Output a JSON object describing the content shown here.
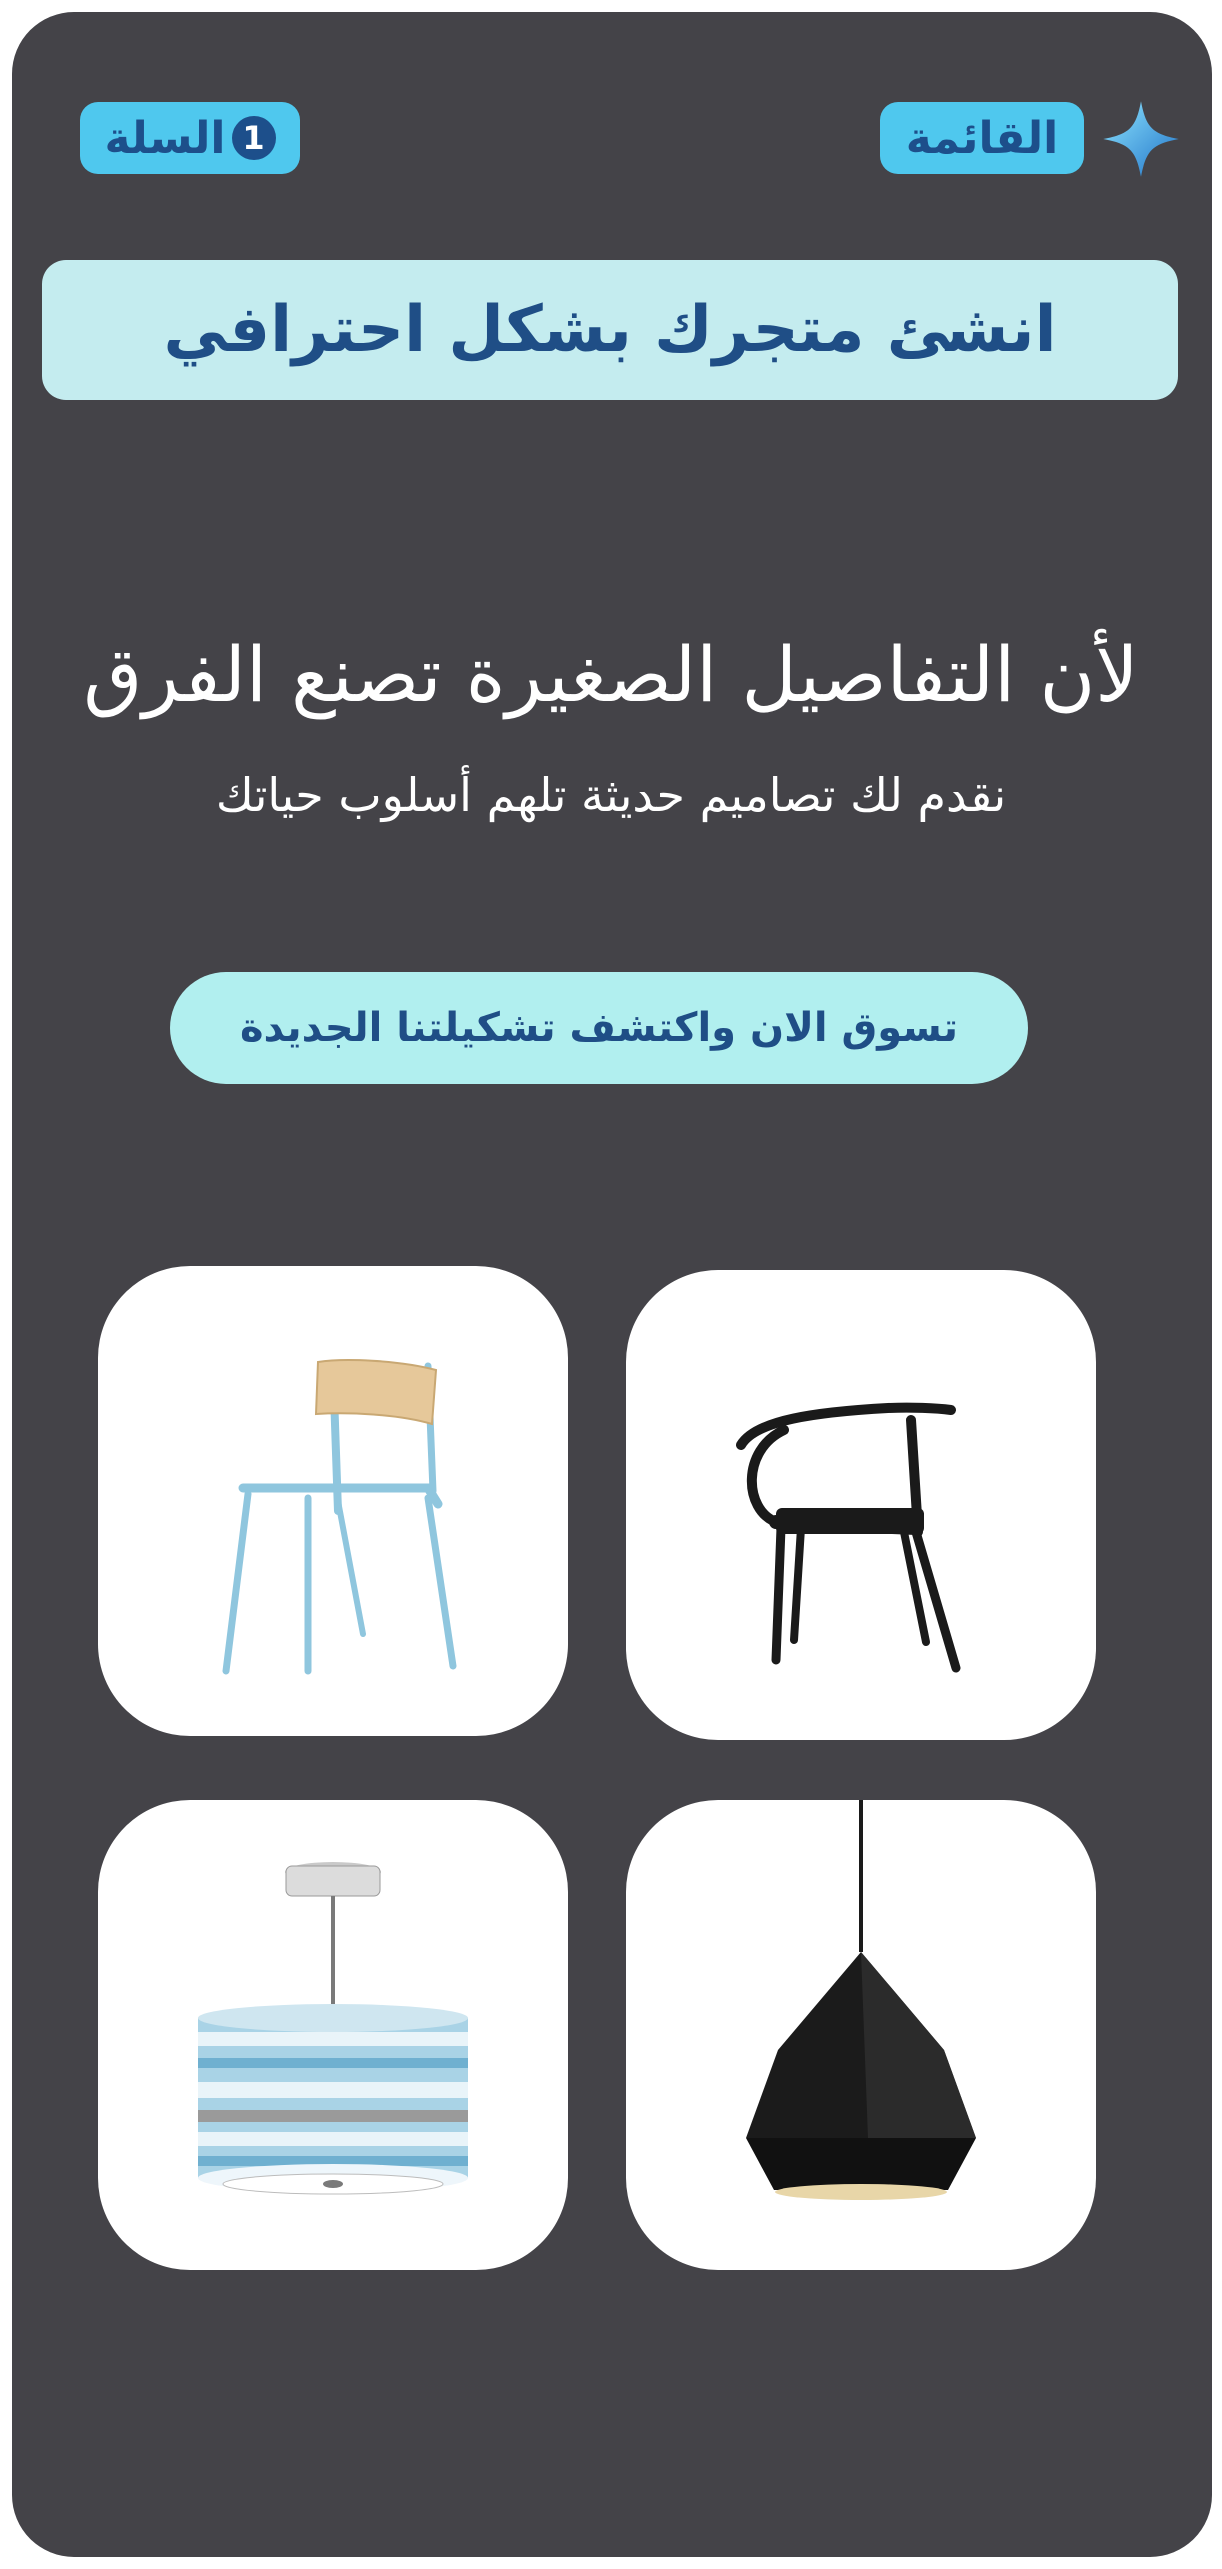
{
  "header": {
    "menu_label": "القائمة",
    "cart_label": "السلة",
    "cart_count": "1",
    "logo_icon": "star-logo-icon",
    "accent_color": "#4fc8ee"
  },
  "banner": {
    "text": "انشئ متجرك بشكل احترافي"
  },
  "hero": {
    "headline": "لأن التفاصيل الصغيرة تصنع الفرق",
    "subheadline": "نقدم لك تصاميم حديثة تلهم أسلوب حياتك"
  },
  "cta": {
    "label": "تسوق الان واكتشف تشكيلتنا الجديدة"
  },
  "products": [
    {
      "name": "black-armchair"
    },
    {
      "name": "blue-chair"
    },
    {
      "name": "black-geometric-pendant"
    },
    {
      "name": "striped-drum-pendant"
    }
  ],
  "colors": {
    "background": "#444348",
    "banner": "#c4ecef",
    "cta": "#b1efef",
    "text_dark_blue": "#1d4f8b"
  }
}
